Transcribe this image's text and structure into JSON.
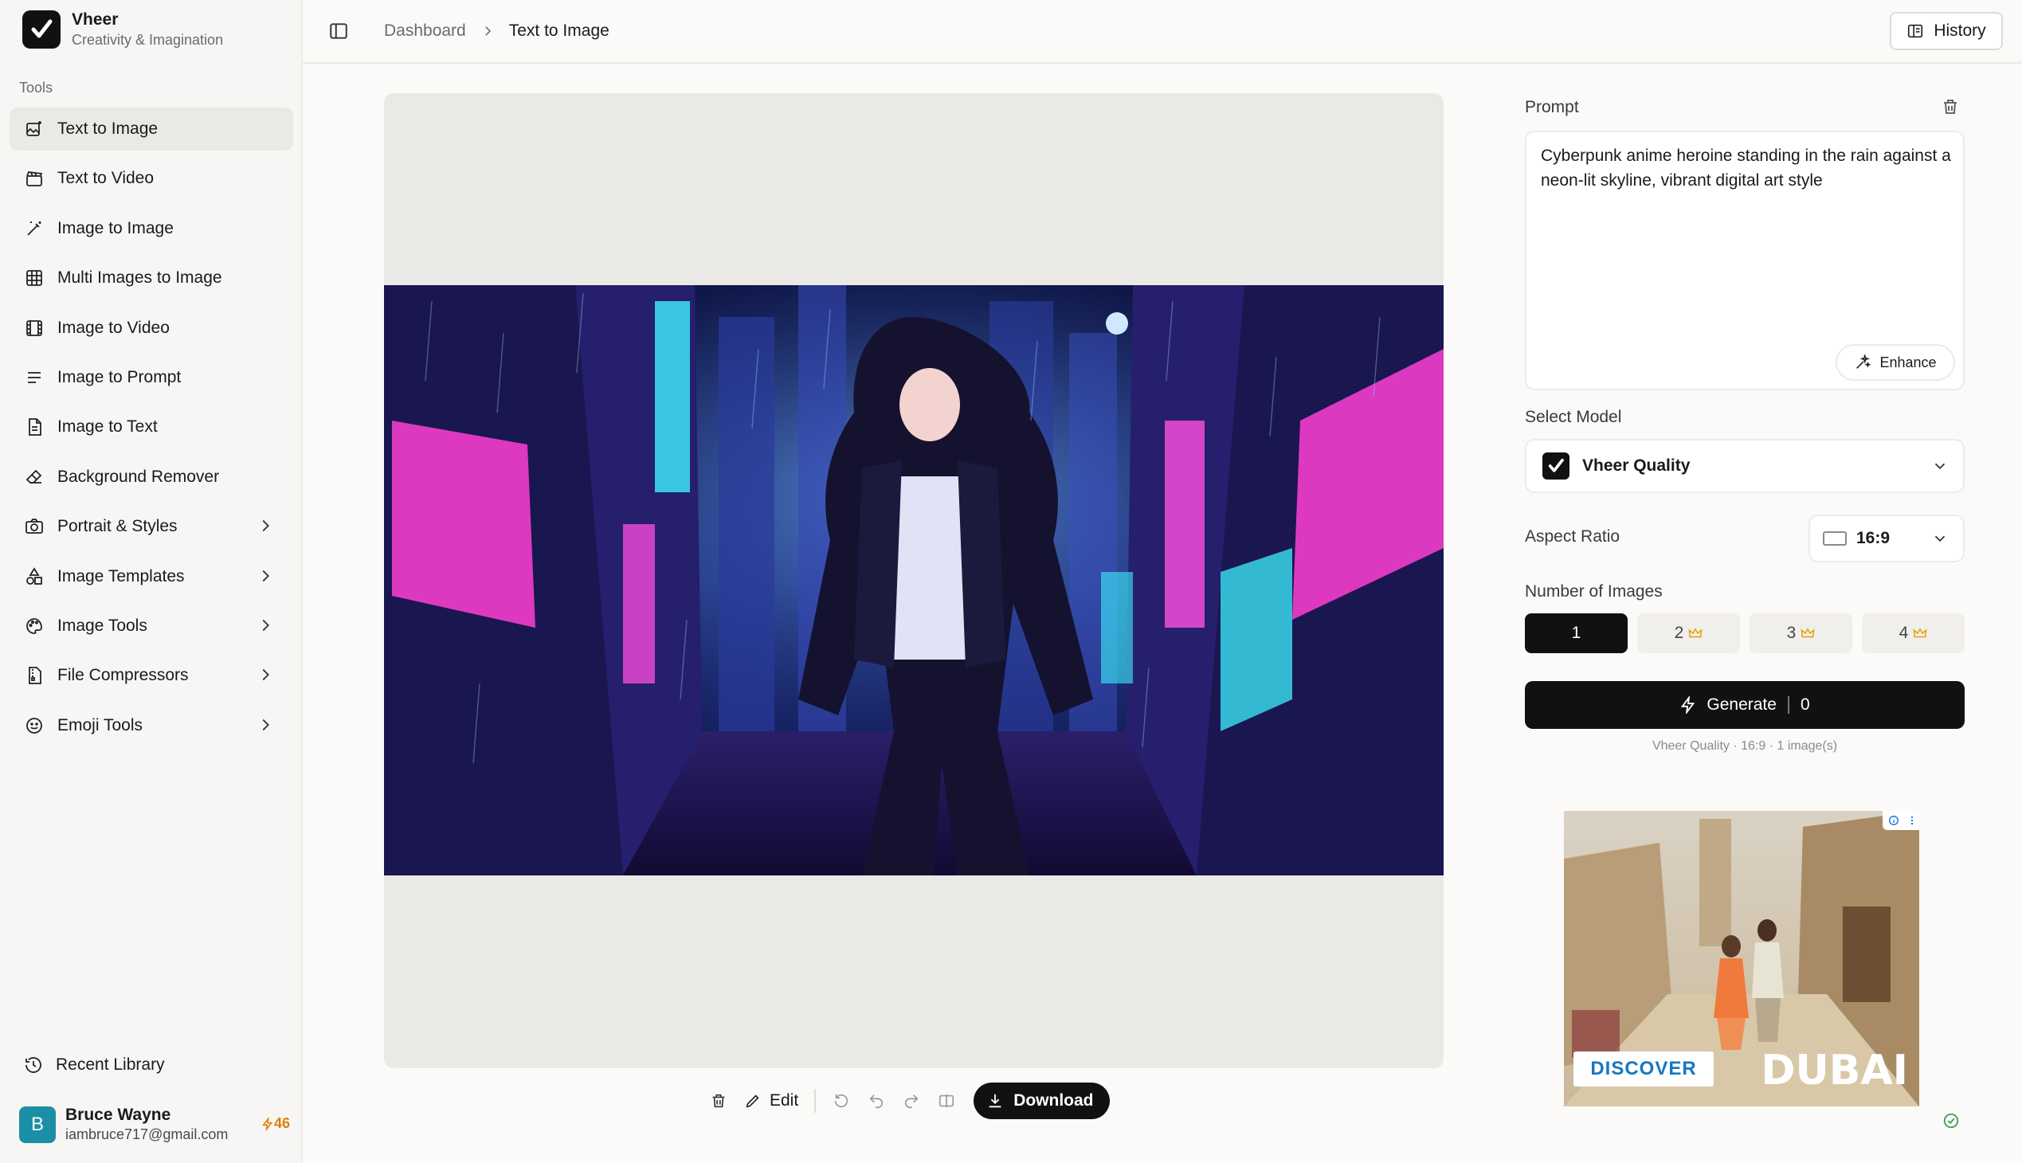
{
  "app": {
    "name": "Vheer",
    "tagline": "Creativity & Imagination"
  },
  "sidebar": {
    "section_label": "Tools",
    "items": [
      {
        "label": "Text to Image",
        "icon": "image-sparkle-icon",
        "active": true,
        "has_submenu": false
      },
      {
        "label": "Text to Video",
        "icon": "clapperboard-icon",
        "active": false,
        "has_submenu": false
      },
      {
        "label": "Image to Image",
        "icon": "magic-wand-icon",
        "active": false,
        "has_submenu": false
      },
      {
        "label": "Multi Images to Image",
        "icon": "grid-icon",
        "active": false,
        "has_submenu": false
      },
      {
        "label": "Image to Video",
        "icon": "film-icon",
        "active": false,
        "has_submenu": false
      },
      {
        "label": "Image to Prompt",
        "icon": "text-lines-icon",
        "active": false,
        "has_submenu": false
      },
      {
        "label": "Image to Text",
        "icon": "document-icon",
        "active": false,
        "has_submenu": false
      },
      {
        "label": "Background Remover",
        "icon": "eraser-icon",
        "active": false,
        "has_submenu": false
      },
      {
        "label": "Portrait & Styles",
        "icon": "camera-icon",
        "active": false,
        "has_submenu": true
      },
      {
        "label": "Image Templates",
        "icon": "shapes-icon",
        "active": false,
        "has_submenu": true
      },
      {
        "label": "Image Tools",
        "icon": "palette-icon",
        "active": false,
        "has_submenu": true
      },
      {
        "label": "File Compressors",
        "icon": "file-zip-icon",
        "active": false,
        "has_submenu": true
      },
      {
        "label": "Emoji Tools",
        "icon": "smiley-icon",
        "active": false,
        "has_submenu": true
      }
    ],
    "recent_label": "Recent Library"
  },
  "user": {
    "initial": "B",
    "name": "Bruce Wayne",
    "email": "iambruce717@gmail.com",
    "credits": "46"
  },
  "header": {
    "breadcrumb": [
      "Dashboard",
      "Text to Image"
    ],
    "history_label": "History"
  },
  "toolbar": {
    "edit_label": "Edit",
    "download_label": "Download"
  },
  "panel": {
    "prompt_label": "Prompt",
    "prompt_text": "Cyberpunk anime heroine standing in the rain against a neon-lit skyline, vibrant digital art style",
    "enhance_label": "Enhance",
    "model_label": "Select Model",
    "model_value": "Vheer Quality",
    "aspect_label": "Aspect Ratio",
    "aspect_value": "16:9",
    "num_label": "Number of Images",
    "num_options": [
      "1",
      "2",
      "3",
      "4"
    ],
    "num_selected": "1",
    "generate_label": "Generate",
    "generate_cost": "0",
    "generate_info": "Vheer Quality · 16:9 · 1 image(s)"
  },
  "ad": {
    "discover": "DISCOVER",
    "brand": "DUBAI"
  },
  "colors": {
    "accent": "#111111",
    "neon_pink": "#ff3fd4",
    "neon_cyan": "#3ef0ff",
    "credit": "#d9820f",
    "avatar": "#1b8fa6"
  }
}
